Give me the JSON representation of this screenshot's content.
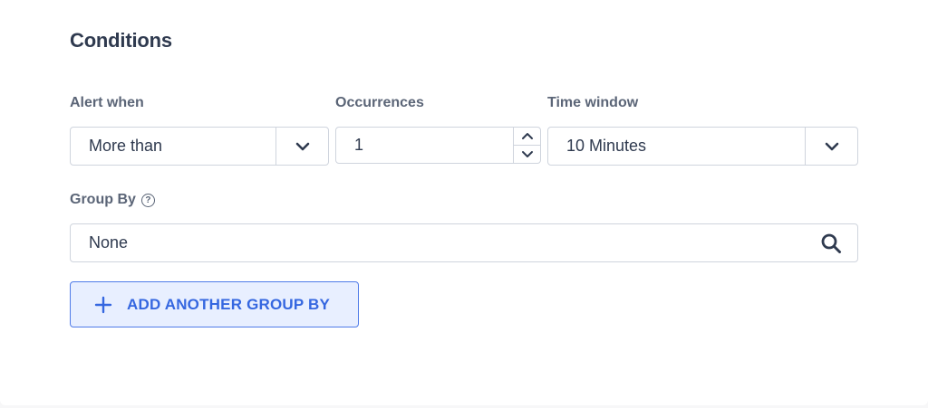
{
  "section": {
    "title": "Conditions"
  },
  "alert_when": {
    "label": "Alert when",
    "value": "More than"
  },
  "occurrences": {
    "label": "Occurrences",
    "value": "1"
  },
  "time_window": {
    "label": "Time window",
    "value": "10 Minutes"
  },
  "group_by": {
    "label": "Group By",
    "help_glyph": "?",
    "value": "None"
  },
  "add_group_by": {
    "label": "ADD ANOTHER GROUP BY"
  },
  "colors": {
    "text_primary": "#2f3a4f",
    "text_label": "#5b6577",
    "border": "#cfd4dd",
    "accent": "#3567e0",
    "accent_bg": "#e8efff"
  },
  "icons": {
    "alert_when_caret": "chevron-down-icon",
    "time_window_caret": "chevron-down-icon",
    "stepper_up": "chevron-up-icon",
    "stepper_down": "chevron-down-icon",
    "group_by_help": "question-circle-icon",
    "group_by_search": "search-icon",
    "add_button": "plus-icon"
  }
}
